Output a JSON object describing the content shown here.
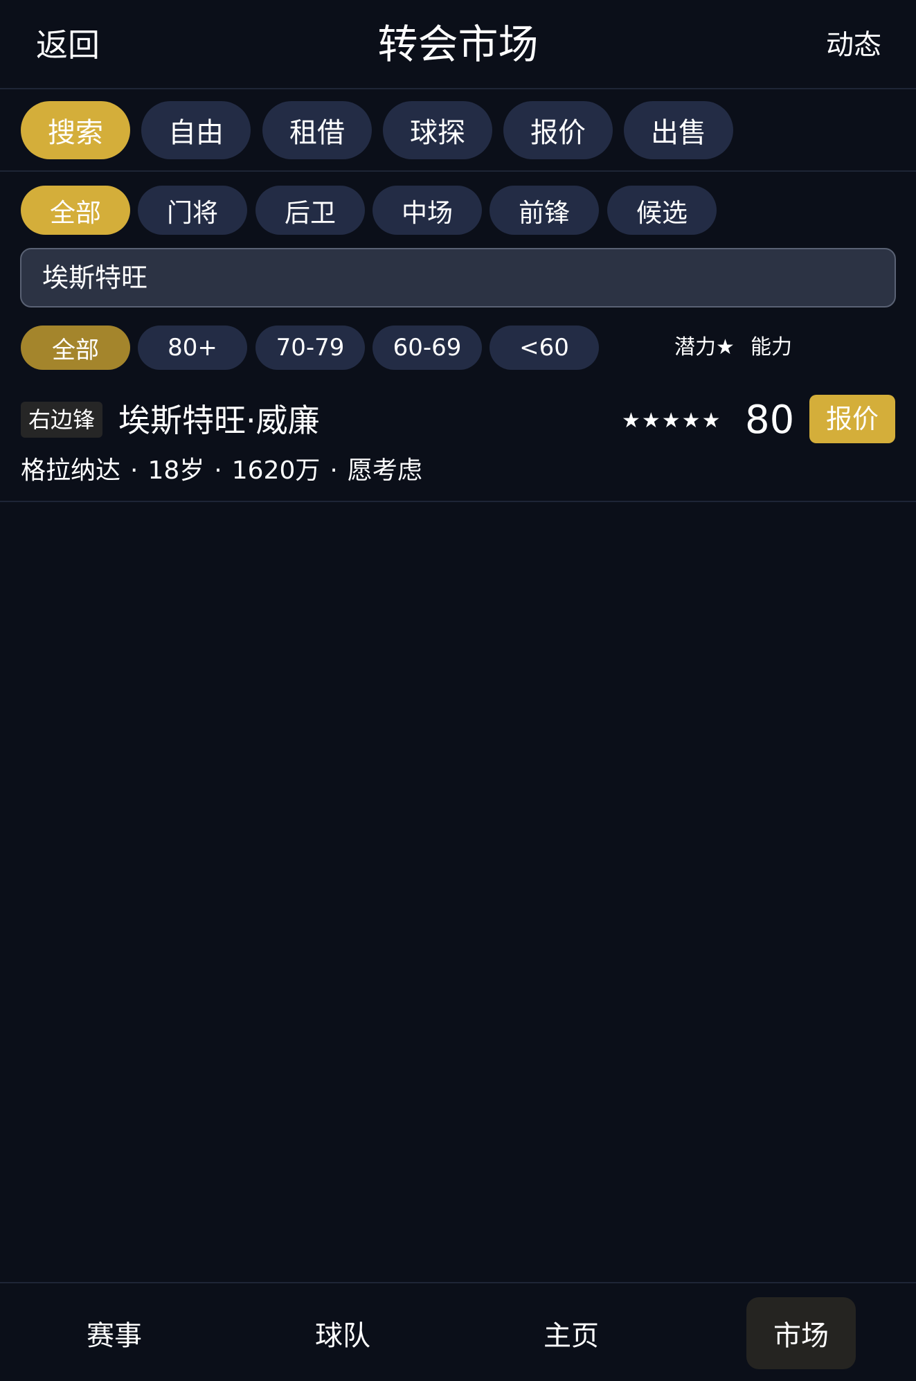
{
  "header": {
    "back_label": "返回",
    "title": "转会市场",
    "feed_label": "动态"
  },
  "tabs": [
    {
      "label": "搜索",
      "active": true
    },
    {
      "label": "自由",
      "active": false
    },
    {
      "label": "租借",
      "active": false
    },
    {
      "label": "球探",
      "active": false
    },
    {
      "label": "报价",
      "active": false
    },
    {
      "label": "出售",
      "active": false
    }
  ],
  "position_filters": [
    {
      "label": "全部",
      "active": true
    },
    {
      "label": "门将",
      "active": false
    },
    {
      "label": "后卫",
      "active": false
    },
    {
      "label": "中场",
      "active": false
    },
    {
      "label": "前锋",
      "active": false
    },
    {
      "label": "候选",
      "active": false
    }
  ],
  "search": {
    "value": "埃斯特旺"
  },
  "rating_filters": [
    {
      "label": "全部",
      "active": true
    },
    {
      "label": "80+",
      "active": false
    },
    {
      "label": "70-79",
      "active": false
    },
    {
      "label": "60-69",
      "active": false
    },
    {
      "label": "<60",
      "active": false
    }
  ],
  "sort": {
    "potential_label": "潜力★",
    "ability_label": "能力"
  },
  "players": [
    {
      "position": "右边锋",
      "name": "埃斯特旺·威廉",
      "stars": "★★★★★",
      "rating": "80",
      "offer_label": "报价",
      "club": "格拉纳达",
      "age": "18岁",
      "value": "1620万",
      "attitude": "愿考虑",
      "separator": "·"
    }
  ],
  "bottom_nav": [
    {
      "label": "赛事",
      "active": false
    },
    {
      "label": "球队",
      "active": false
    },
    {
      "label": "主页",
      "active": false
    },
    {
      "label": "市场",
      "active": true
    }
  ],
  "colors": {
    "background": "#0b0f19",
    "accent": "#d4ae3a",
    "pill": "#232c45"
  }
}
